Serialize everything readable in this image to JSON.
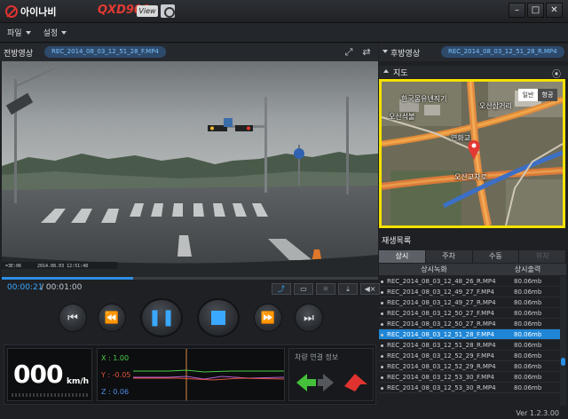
{
  "titlebar": {
    "logo_text": "아이나비",
    "model": "QXD900",
    "view_badge": "View",
    "minimize": "–",
    "maximize": "□",
    "close": "✕"
  },
  "menu": [
    {
      "label": "파일"
    },
    {
      "label": "설정"
    }
  ],
  "front": {
    "label": "전방영상",
    "file": "REC_2014_08_03_12_51_28_F.MP4",
    "overlay_left": "=3E:06",
    "overlay_right": "2014.08.03 12:51:48"
  },
  "rear": {
    "label": "후방영상",
    "file": "REC_2014_08_03_12_51_28_R.MP4"
  },
  "playback": {
    "current_time": "00:00:21",
    "separator": "/",
    "total_time": "00:01:00",
    "progress": 0.35
  },
  "map": {
    "label": "지도",
    "tab_normal": "일반",
    "tab_aerial": "항공",
    "labels": [
      "한국몽유넨직기",
      "오산삼거리",
      "오산석불",
      "연화교",
      "오산교차로"
    ]
  },
  "playlist": {
    "label": "재생목록",
    "tabs": [
      "상시",
      "주차",
      "수동",
      "위치"
    ],
    "columns": [
      "상시녹화",
      "상시출력"
    ],
    "rows": [
      {
        "name": "REC_2014_08_03_12_48_26_R.MP4",
        "size": "80.06mb",
        "selected": false
      },
      {
        "name": "REC_2014_08_03_12_49_27_F.MP4",
        "size": "80.06mb",
        "selected": false
      },
      {
        "name": "REC_2014_08_03_12_49_27_R.MP4",
        "size": "80.06mb",
        "selected": false
      },
      {
        "name": "REC_2014_08_03_12_50_27_F.MP4",
        "size": "80.06mb",
        "selected": false
      },
      {
        "name": "REC_2014_08_03_12_50_27_R.MP4",
        "size": "80.06mb",
        "selected": false
      },
      {
        "name": "REC_2014_08_03_12_51_28_F.MP4",
        "size": "80.06mb",
        "selected": true
      },
      {
        "name": "REC_2014_08_03_12_51_28_R.MP4",
        "size": "80.06mb",
        "selected": false
      },
      {
        "name": "REC_2014_08_03_12_52_29_F.MP4",
        "size": "80.06mb",
        "selected": false
      },
      {
        "name": "REC_2014_08_03_12_52_29_R.MP4",
        "size": "80.06mb",
        "selected": false
      },
      {
        "name": "REC_2014_08_03_12_53_30_F.MP4",
        "size": "80.06mb",
        "selected": false
      },
      {
        "name": "REC_2014_08_03_12_53_30_R.MP4",
        "size": "80.06mb",
        "selected": false
      }
    ]
  },
  "speed": {
    "value": "000",
    "unit": "km/h"
  },
  "gsensor": {
    "x": "X : 1.00",
    "y": "Y : -0.05",
    "z": "Z : 0.06"
  },
  "connection": {
    "title": "차량 연결 정보"
  },
  "version": "Ver 1.2.3.00",
  "colors": {
    "accent": "#1f86d6",
    "brand_red": "#e0332f",
    "map_highlight": "#f5e100"
  }
}
